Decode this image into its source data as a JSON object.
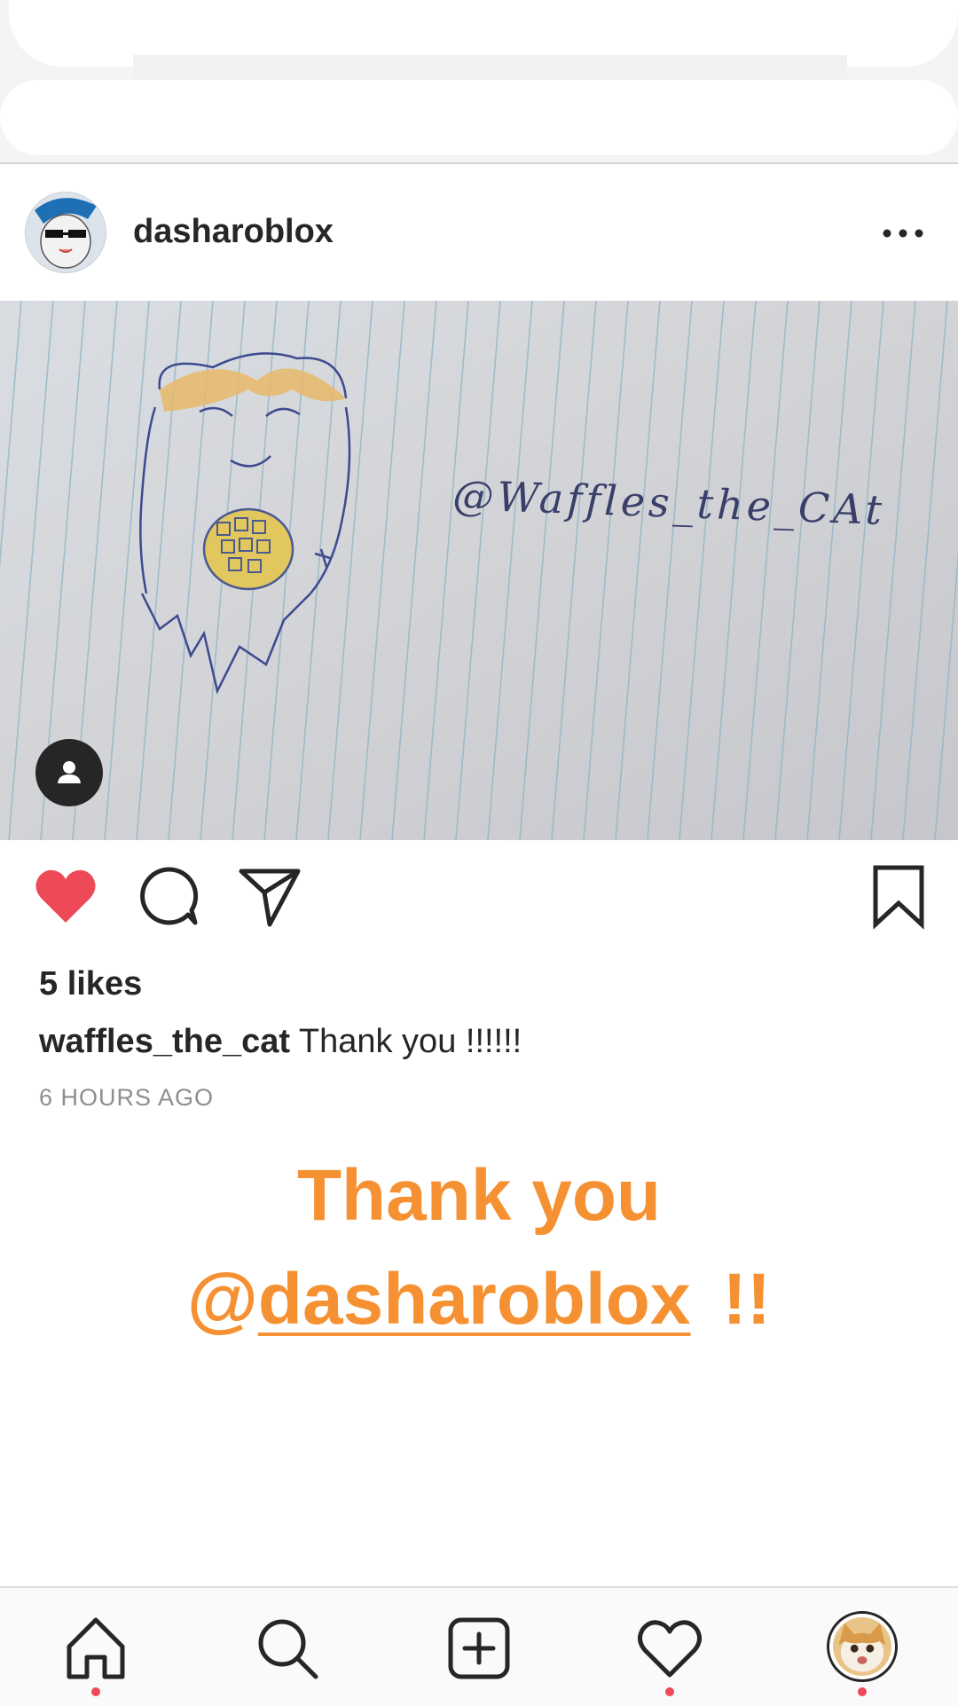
{
  "post": {
    "username": "dasharoblox",
    "image": {
      "handwritten_text": "@Waffles_the_CAt"
    },
    "likes_text": "5 likes",
    "caption": {
      "username": "waffles_the_cat",
      "text": "Thank you !!!!!!"
    },
    "timestamp": "6 HOURS AGO",
    "liked": true
  },
  "overlay": {
    "line1": "Thank you",
    "mention_at": "@",
    "mention_handle": "dasharoblox",
    "exclaim": "!!",
    "color": "#f59132"
  },
  "icons": {
    "more": "more-dots-icon",
    "tag": "person-tag-icon",
    "like": "heart-filled-icon",
    "comment": "comment-bubble-icon",
    "share": "paper-plane-icon",
    "save": "bookmark-icon",
    "home": "home-icon",
    "search": "search-icon",
    "create": "add-post-icon",
    "activity": "heart-outline-icon",
    "profile": "profile-avatar-icon"
  },
  "colors": {
    "like_red": "#ed4956",
    "text": "#262626",
    "secondary": "#8e8e8e"
  }
}
